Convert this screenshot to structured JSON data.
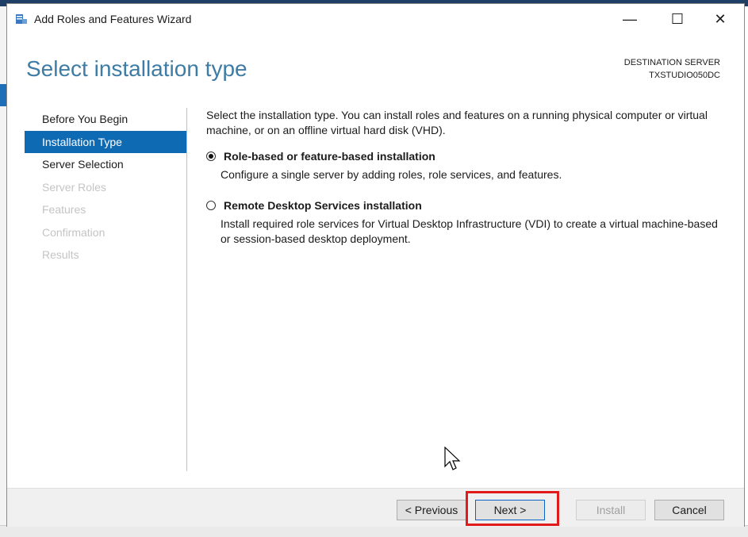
{
  "window": {
    "title": "Add Roles and Features Wizard",
    "minimize_glyph": "—",
    "maximize_glyph": "☐",
    "close_glyph": "✕"
  },
  "header": {
    "page_title": "Select installation type",
    "destination_label": "DESTINATION SERVER",
    "destination_name": "TXSTUDIO050DC"
  },
  "nav": {
    "items": [
      {
        "label": "Before You Begin",
        "state": "normal"
      },
      {
        "label": "Installation Type",
        "state": "active"
      },
      {
        "label": "Server Selection",
        "state": "normal"
      },
      {
        "label": "Server Roles",
        "state": "disabled"
      },
      {
        "label": "Features",
        "state": "disabled"
      },
      {
        "label": "Confirmation",
        "state": "disabled"
      },
      {
        "label": "Results",
        "state": "disabled"
      }
    ]
  },
  "content": {
    "intro": "Select the installation type. You can install roles and features on a running physical computer or virtual machine, or on an offline virtual hard disk (VHD).",
    "options": [
      {
        "title": "Role-based or feature-based installation",
        "description": "Configure a single server by adding roles, role services, and features.",
        "selected": true
      },
      {
        "title": "Remote Desktop Services installation",
        "description": "Install required role services for Virtual Desktop Infrastructure (VDI) to create a virtual machine-based or session-based desktop deployment.",
        "selected": false
      }
    ]
  },
  "footer": {
    "previous_label": "< Previous",
    "next_label": "Next >",
    "install_label": "Install",
    "cancel_label": "Cancel"
  },
  "colors": {
    "accent": "#0f6ab4",
    "title_blue": "#3e7ca6",
    "highlight_red": "#e11b1b"
  }
}
